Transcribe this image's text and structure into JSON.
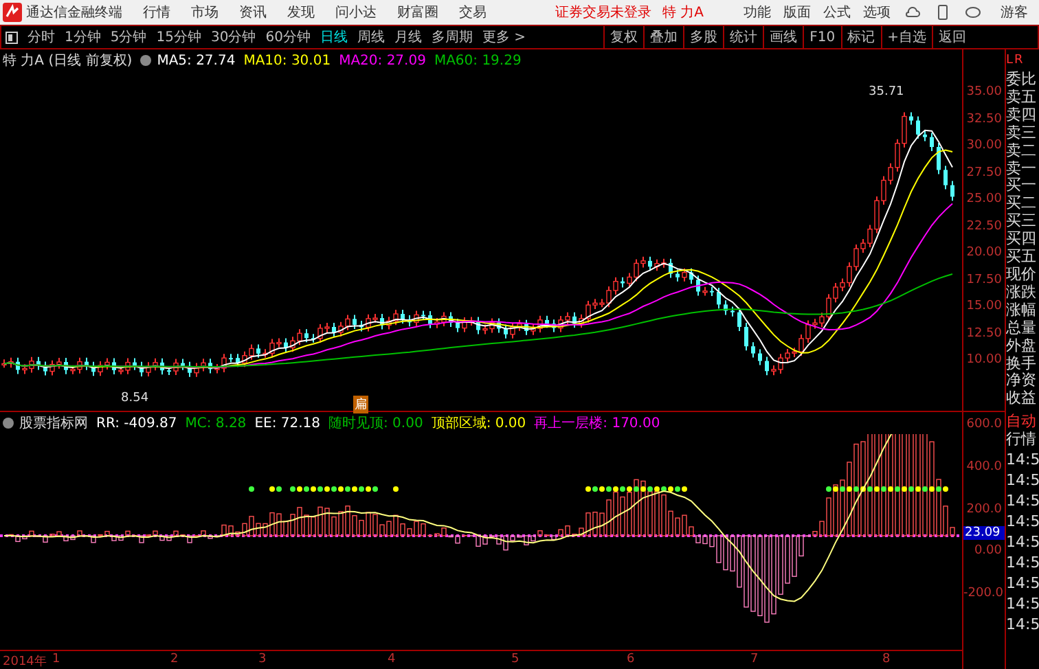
{
  "menu_bar": {
    "app_title": "通达信金融终端",
    "items": [
      "行情",
      "市场",
      "资讯",
      "发现",
      "问小达",
      "财富圈",
      "交易"
    ],
    "login_status": "证券交易未登录",
    "stock_name": "特 力A",
    "tools": [
      "功能",
      "版面",
      "公式",
      "选项"
    ],
    "user": "游客"
  },
  "period_tabs": [
    {
      "label": "分时",
      "selected": false
    },
    {
      "label": "1分钟",
      "selected": false
    },
    {
      "label": "5分钟",
      "selected": false
    },
    {
      "label": "15分钟",
      "selected": false
    },
    {
      "label": "30分钟",
      "selected": false
    },
    {
      "label": "60分钟",
      "selected": false
    },
    {
      "label": "日线",
      "selected": true
    },
    {
      "label": "周线",
      "selected": false
    },
    {
      "label": "月线",
      "selected": false
    },
    {
      "label": "多周期",
      "selected": false
    },
    {
      "label": "更多 >",
      "selected": false
    }
  ],
  "chart_tools": [
    "复权",
    "叠加",
    "多股",
    "统计",
    "画线",
    "F10",
    "标记",
    "+自选",
    "返回"
  ],
  "main_chart": {
    "title": "特 力A (日线 前复权)",
    "indicators": [
      {
        "label": "MA5: 27.74",
        "color": "#ffffff"
      },
      {
        "label": "MA10: 30.01",
        "color": "#ffff00"
      },
      {
        "label": "MA20: 27.09",
        "color": "#ff00ff"
      },
      {
        "label": "MA60: 19.29",
        "color": "#00c000"
      }
    ],
    "high_label": "35.71",
    "low_label": "8.54",
    "marker": "扁",
    "price_ticks": [
      "35.00",
      "32.50",
      "30.00",
      "27.50",
      "25.00",
      "22.50",
      "20.00",
      "17.50",
      "15.00",
      "12.50",
      "10.00"
    ]
  },
  "indicator_chart": {
    "title": "股票指标网",
    "values": [
      {
        "label": "RR: -409.87",
        "color": "#ffffff"
      },
      {
        "label": "MC: 8.28",
        "color": "#00c000"
      },
      {
        "label": "EE: 72.18",
        "color": "#ffffff"
      },
      {
        "label": "随时见顶: 0.00",
        "color": "#00c000"
      },
      {
        "label": "顶部区域: 0.00",
        "color": "#ffff00"
      },
      {
        "label": "再上一层楼: 170.00",
        "color": "#ff00ff"
      }
    ],
    "ticks": [
      "600.0",
      "400.0",
      "200.0",
      "0.00",
      "-200.0"
    ],
    "current_value": "23.09"
  },
  "date_axis": [
    "2014年",
    "1",
    "2",
    "3",
    "4",
    "5",
    "6",
    "7",
    "8"
  ],
  "quote_panel": {
    "header": [
      "L",
      "R"
    ],
    "labels": [
      "委比",
      "卖五",
      "卖四",
      "卖三",
      "卖二",
      "卖一",
      "买一",
      "买二",
      "买三",
      "买四",
      "买五",
      "现价",
      "涨跌",
      "涨幅",
      "总量",
      "外盘",
      "换手",
      "净资",
      "收益"
    ],
    "auto_label": "自动",
    "ticks_label": "行情",
    "times": [
      "14:5",
      "14:5",
      "14:5",
      "14:5",
      "14:5",
      "14:5",
      "14:5",
      "14:5",
      "14:5"
    ]
  }
}
